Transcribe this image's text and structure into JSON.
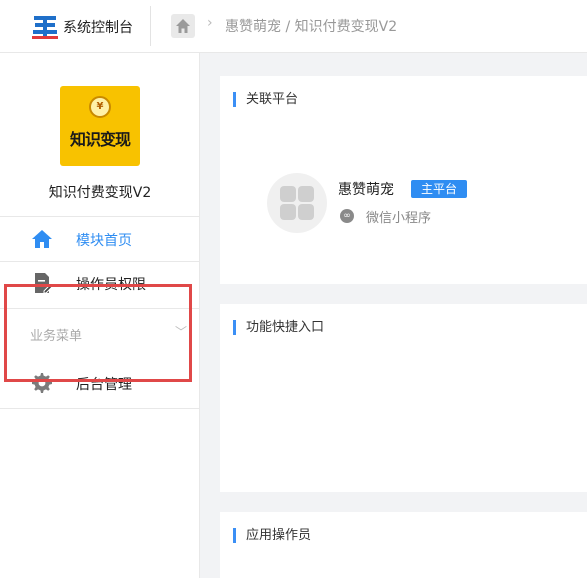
{
  "header": {
    "logo_icon": "system-logo-icon",
    "title": "系统控制台",
    "home_icon": "home-icon",
    "breadcrumb": "惠赞萌宠 / 知识付费变现V2"
  },
  "sidebar": {
    "app": {
      "icon_text": "知识变现",
      "coin_symbol": "¥",
      "name": "知识付费变现V2"
    },
    "items": [
      {
        "label": "模块首页",
        "icon": "home-icon",
        "active": true,
        "color": "#2f8df2"
      },
      {
        "label": "操作员权限",
        "icon": "document-edit-icon",
        "active": false
      }
    ],
    "section_label": "业务菜单",
    "section_items": [
      {
        "label": "后台管理",
        "icon": "gear-icon"
      }
    ]
  },
  "main": {
    "linked_platform": {
      "title": "关联平台",
      "platform_name": "惠赞萌宠",
      "badge": "主平台",
      "type_label": "微信小程序",
      "type_icon": "mini-program-icon"
    },
    "quick_entry": {
      "title": "功能快捷入口"
    },
    "operators": {
      "title": "应用操作员"
    }
  },
  "colors": {
    "accent": "#2f8df2",
    "highlight_box": "#e04848",
    "app_icon_bg": "#f8c200"
  }
}
